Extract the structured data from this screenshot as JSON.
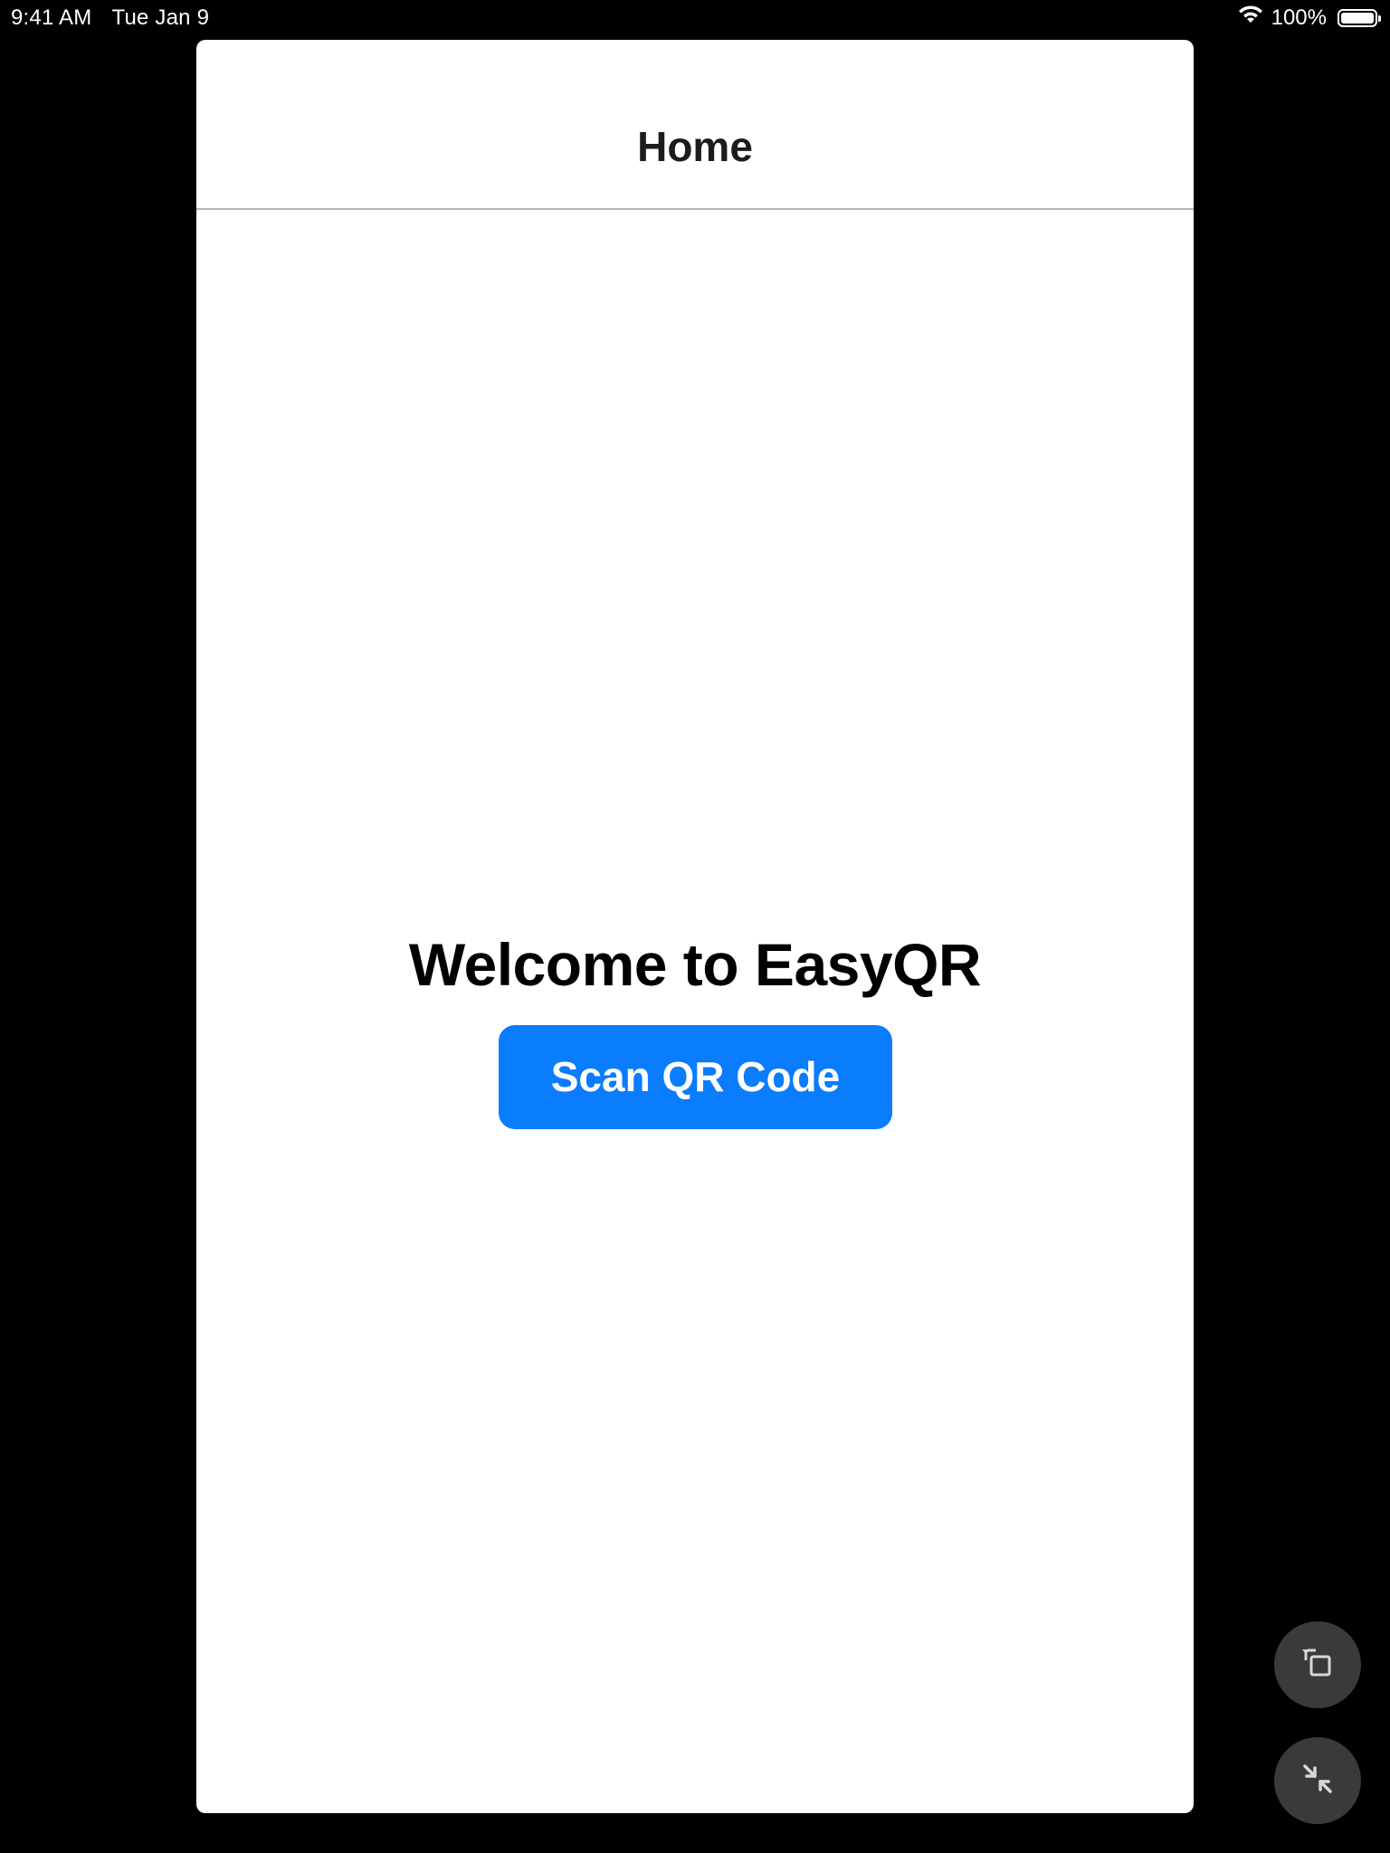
{
  "status_bar": {
    "time": "9:41 AM",
    "date": "Tue Jan 9",
    "battery_percent": "100%",
    "battery_level": 1.0,
    "icons": [
      "wifi-icon",
      "battery-icon"
    ]
  },
  "nav": {
    "title": "Home"
  },
  "main": {
    "welcome_text": "Welcome to EasyQR",
    "scan_button_label": "Scan QR Code"
  },
  "floating_controls": {
    "rotate_icon": "rotate-screen-icon",
    "collapse_icon": "collapse-arrows-icon"
  },
  "colors": {
    "accent": "#0a7cfe",
    "background": "#000000",
    "window": "#ffffff",
    "floating_button": "#3a3a3c"
  }
}
